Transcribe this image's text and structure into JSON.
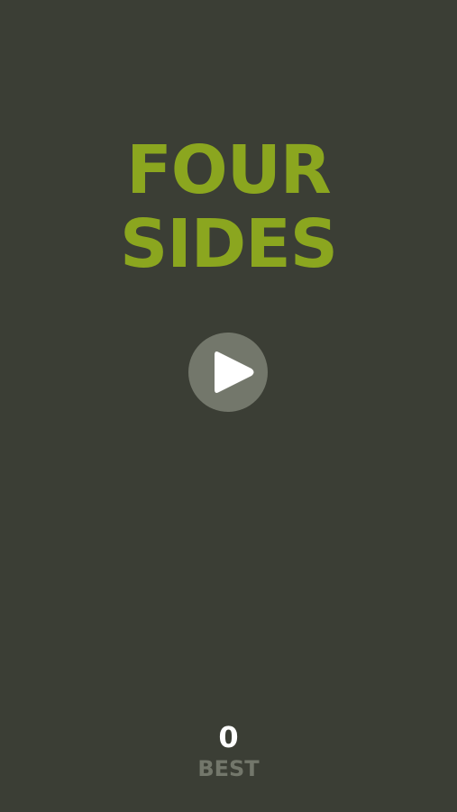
{
  "title": {
    "line1": "FOUR",
    "line2": "SIDES"
  },
  "play": {
    "icon": "play-icon"
  },
  "best": {
    "value": "0",
    "label": "BEST"
  },
  "colors": {
    "background": "#3b3e35",
    "title": "#8ba61f",
    "button": "#73776b",
    "score": "#ffffff",
    "label": "#73776b"
  }
}
